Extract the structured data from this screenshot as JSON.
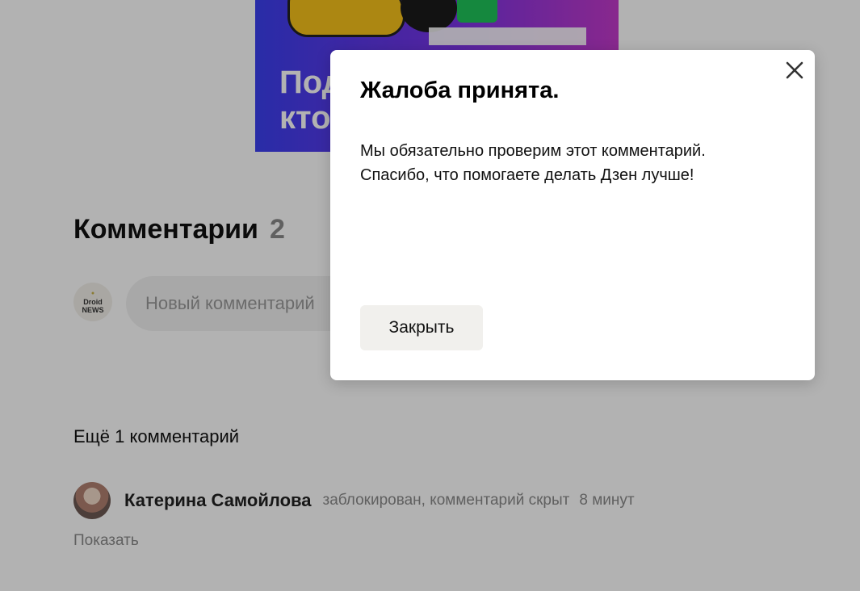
{
  "promo": {
    "text": "Под\nкто"
  },
  "comments": {
    "title": "Комментарии",
    "count": "2",
    "author_avatar_text_top": "Droid",
    "author_avatar_text_bottom": "NEWS",
    "new_comment_placeholder": "Новый комментарий",
    "more_label": "Ещё 1 комментарий",
    "items": [
      {
        "author": "Катерина Самойлова",
        "status": "заблокирован, комментарий скрыт",
        "time": "8 минут",
        "show_label": "Показать"
      }
    ]
  },
  "dialog": {
    "title": "Жалоба принята.",
    "line1": "Мы обязательно проверим этот комментарий.",
    "line2": "Спасибо, что помогаете делать Дзен лучше!",
    "button_label": "Закрыть",
    "close_icon": "close-icon"
  },
  "colors": {
    "overlay": "rgba(0,0,0,0.30)",
    "dialog_button_bg": "#f1f0ed",
    "muted_text": "#8a8a8a"
  }
}
